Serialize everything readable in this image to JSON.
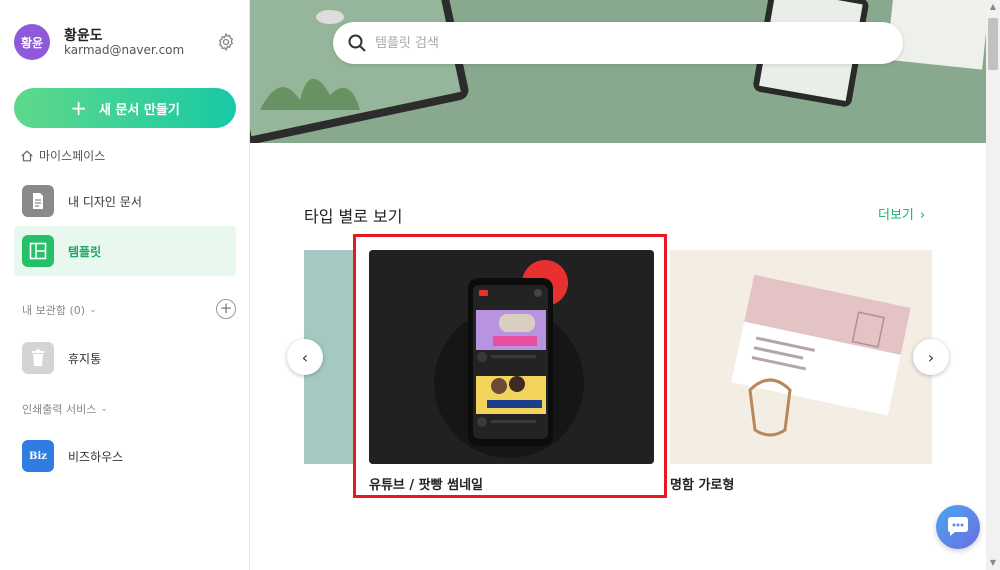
{
  "profile": {
    "avatar_text": "황윤",
    "name": "황윤도",
    "email": "karmad@naver.com"
  },
  "sidebar": {
    "new_doc_label": "새 문서 만들기",
    "space_title": "마이스페이스",
    "items": [
      {
        "label": "내 디자인 문서",
        "icon": "document-icon"
      },
      {
        "label": "템플릿",
        "icon": "template-icon"
      }
    ],
    "storage_title": "내 보관함 (0)",
    "trash_label": "휴지통",
    "print_title": "인쇄출력 서비스",
    "bizhouse_label": "비즈하우스",
    "biz_logo": "Biz"
  },
  "search": {
    "placeholder": "템플릿 검색"
  },
  "main": {
    "section_title": "타입 별로 보기",
    "more_label": "더보기",
    "cards": [
      {
        "label": "유튜브 / 팟빵 썸네일"
      },
      {
        "label": "명함 가로형"
      }
    ]
  },
  "colors": {
    "accent_green": "#17b36b",
    "highlight_red": "#e8181e",
    "avatar_purple": "#8f5ad9"
  }
}
